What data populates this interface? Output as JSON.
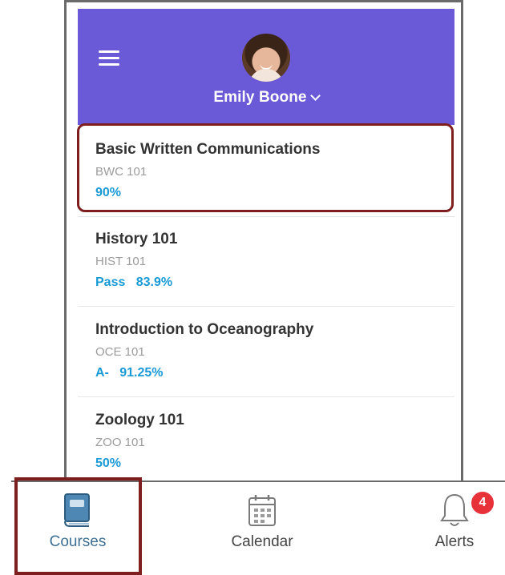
{
  "header": {
    "user_name": "Emily Boone",
    "accent_color": "#6a5ad8"
  },
  "courses": [
    {
      "title": "Basic Written Communications",
      "code": "BWC 101",
      "grade": "90%"
    },
    {
      "title": "History 101",
      "code": "HIST 101",
      "grade": "Pass   83.9%"
    },
    {
      "title": "Introduction to Oceanography",
      "code": "OCE 101",
      "grade": "A-   91.25%"
    },
    {
      "title": "Zoology 101",
      "code": "ZOO 101",
      "grade": "50%"
    }
  ],
  "tabbar": {
    "tabs": [
      {
        "label": "Courses",
        "icon": "book-icon",
        "active": true
      },
      {
        "label": "Calendar",
        "icon": "calendar-icon",
        "active": false
      },
      {
        "label": "Alerts",
        "icon": "bell-icon",
        "active": false
      }
    ],
    "alerts_badge": "4"
  }
}
